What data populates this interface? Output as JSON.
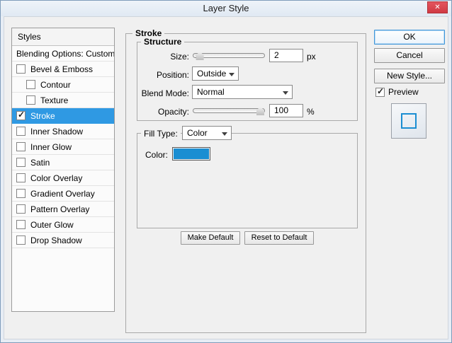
{
  "window": {
    "title": "Layer Style",
    "close_label": "✕"
  },
  "styles_panel": {
    "header": "Styles",
    "items": [
      {
        "label": "Blending Options: Custom",
        "checkbox": false,
        "checked": false,
        "selected": false,
        "indent": false
      },
      {
        "label": "Bevel & Emboss",
        "checkbox": true,
        "checked": false,
        "selected": false,
        "indent": false
      },
      {
        "label": "Contour",
        "checkbox": true,
        "checked": false,
        "selected": false,
        "indent": true
      },
      {
        "label": "Texture",
        "checkbox": true,
        "checked": false,
        "selected": false,
        "indent": true
      },
      {
        "label": "Stroke",
        "checkbox": true,
        "checked": true,
        "selected": true,
        "indent": false
      },
      {
        "label": "Inner Shadow",
        "checkbox": true,
        "checked": false,
        "selected": false,
        "indent": false
      },
      {
        "label": "Inner Glow",
        "checkbox": true,
        "checked": false,
        "selected": false,
        "indent": false
      },
      {
        "label": "Satin",
        "checkbox": true,
        "checked": false,
        "selected": false,
        "indent": false
      },
      {
        "label": "Color Overlay",
        "checkbox": true,
        "checked": false,
        "selected": false,
        "indent": false
      },
      {
        "label": "Gradient Overlay",
        "checkbox": true,
        "checked": false,
        "selected": false,
        "indent": false
      },
      {
        "label": "Pattern Overlay",
        "checkbox": true,
        "checked": false,
        "selected": false,
        "indent": false
      },
      {
        "label": "Outer Glow",
        "checkbox": true,
        "checked": false,
        "selected": false,
        "indent": false
      },
      {
        "label": "Drop Shadow",
        "checkbox": true,
        "checked": false,
        "selected": false,
        "indent": false
      }
    ]
  },
  "stroke_panel": {
    "title": "Stroke",
    "structure": {
      "title": "Structure",
      "size": {
        "label": "Size:",
        "value": "2",
        "unit": "px",
        "slider_percent": 4
      },
      "position": {
        "label": "Position:",
        "value": "Outside"
      },
      "blend_mode": {
        "label": "Blend Mode:",
        "value": "Normal"
      },
      "opacity": {
        "label": "Opacity:",
        "value": "100",
        "unit": "%",
        "slider_percent": 100
      }
    },
    "fill": {
      "fill_type_label": "Fill Type:",
      "fill_type_value": "Color",
      "color_label": "Color:",
      "color_value": "#1b8ed2"
    },
    "buttons": {
      "make_default": "Make Default",
      "reset_to_default": "Reset to Default"
    }
  },
  "actions": {
    "ok": "OK",
    "cancel": "Cancel",
    "new_style": "New Style...",
    "preview": "Preview",
    "preview_checked": true
  }
}
